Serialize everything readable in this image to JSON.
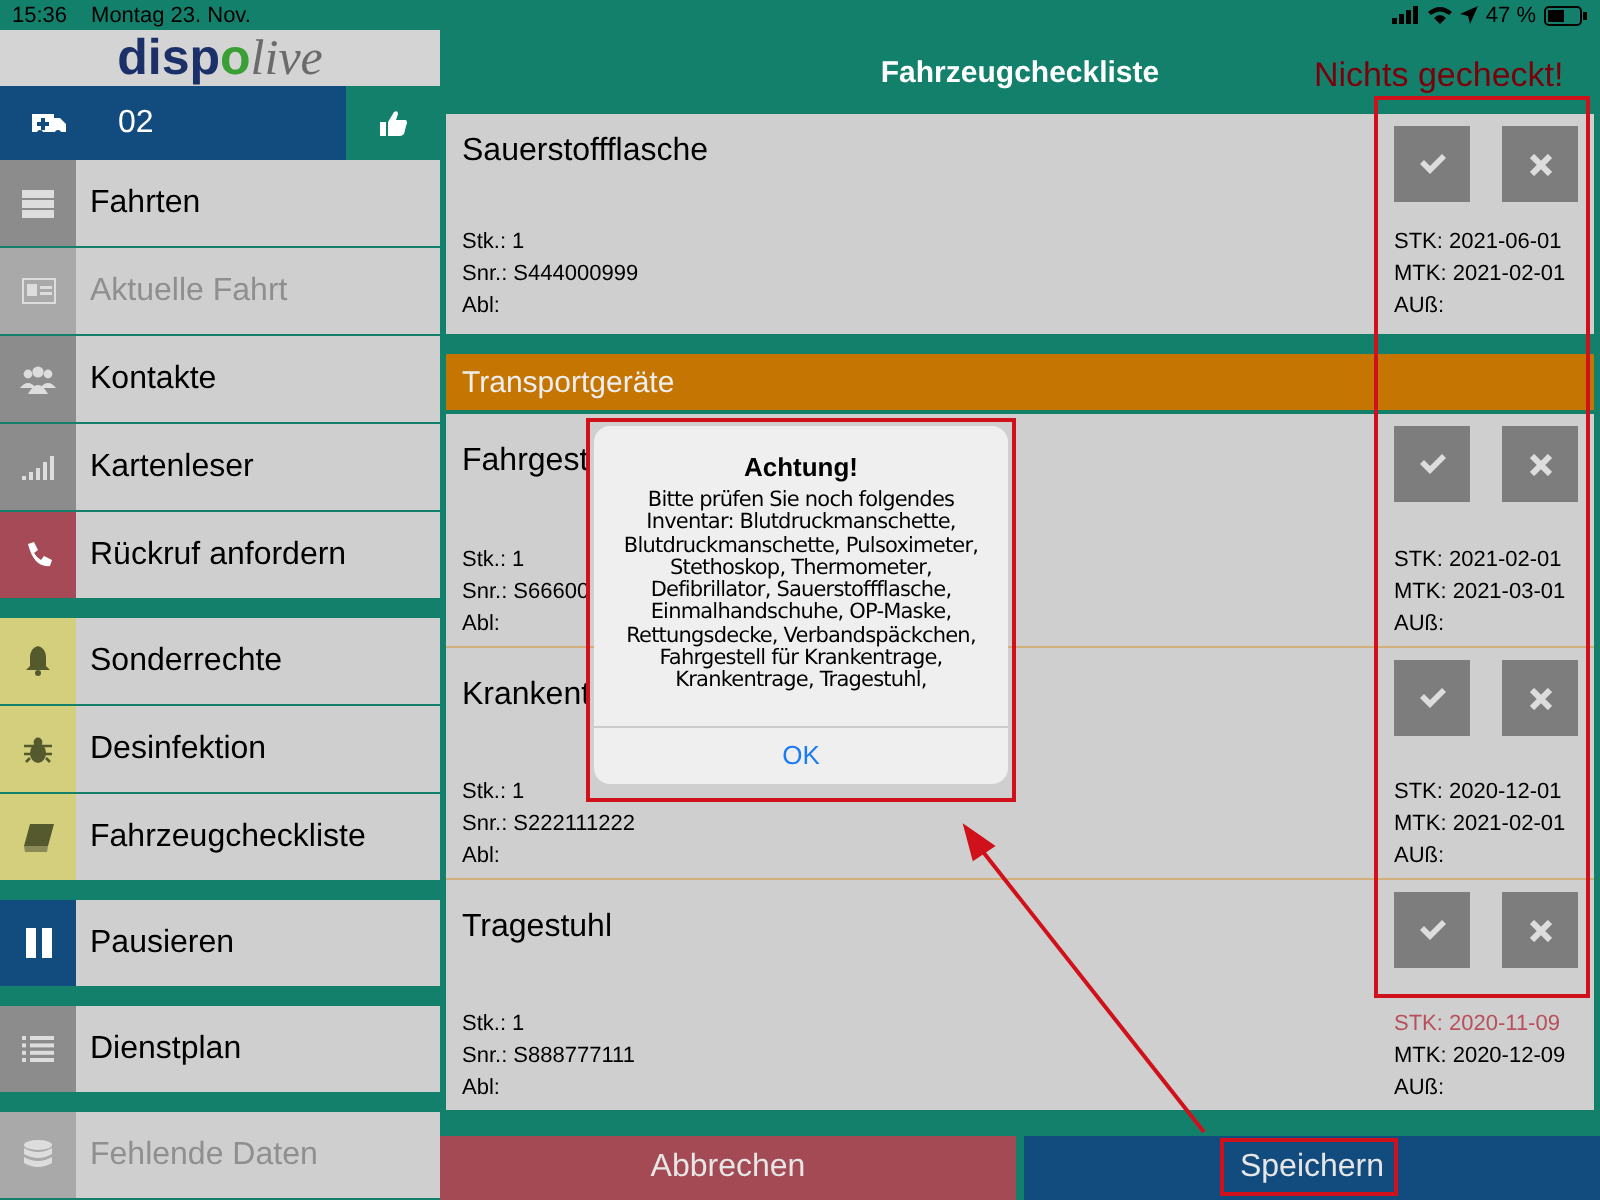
{
  "status_bar": {
    "time": "15:36",
    "date": "Montag 23. Nov.",
    "battery": "47 %"
  },
  "logo": {
    "primary": "disp",
    "accent": "o",
    "secondary": "live"
  },
  "vehicle": {
    "number": "02"
  },
  "sidebar": {
    "groups": [
      [
        {
          "label": "Fahrten",
          "kind": "list",
          "color": "#8c8c8c",
          "disabled": false
        },
        {
          "label": "Aktuelle Fahrt",
          "kind": "card",
          "color": "#a9a9a9",
          "disabled": true
        },
        {
          "label": "Kontakte",
          "kind": "people",
          "color": "#8c8c8c",
          "disabled": false
        },
        {
          "label": "Kartenleser",
          "kind": "signal",
          "color": "#8c8c8c",
          "disabled": false
        },
        {
          "label": "Rückruf anfordern",
          "kind": "phone",
          "color": "#a74a57",
          "disabled": false
        }
      ],
      [
        {
          "label": "Sonderrechte",
          "kind": "bell",
          "color": "#d3cf7d",
          "disabled": false
        },
        {
          "label": "Desinfektion",
          "kind": "bug",
          "color": "#d3cf7d",
          "disabled": false
        },
        {
          "label": "Fahrzeugcheckliste",
          "kind": "book",
          "color": "#d3cf7d",
          "disabled": false
        }
      ],
      [
        {
          "label": "Pausieren",
          "kind": "pause",
          "color": "#124c7e",
          "disabled": false
        }
      ],
      [
        {
          "label": "Dienstplan",
          "kind": "lines",
          "color": "#8c8c8c",
          "disabled": false
        }
      ],
      [
        {
          "label": "Fehlende Daten",
          "kind": "database",
          "color": "#a9a9a9",
          "disabled": true
        }
      ]
    ]
  },
  "header": {
    "title": "Fahrzeugcheckliste"
  },
  "checklist": [
    {
      "kind": "item",
      "title": "Sauerstoffflasche",
      "stk_count": "Stk.: 1",
      "serial": "Snr.: S444000999",
      "abl": "Abl:",
      "stk": "STK: 2021-06-01",
      "stk_overdue": false,
      "mtk": "MTK: 2021-02-01",
      "aus": "AUß:",
      "ok": false,
      "defect": false
    },
    {
      "kind": "category",
      "title": "Transportgeräte"
    },
    {
      "kind": "item",
      "title": "Fahrgest",
      "stk_count": "Stk.: 1",
      "serial": "Snr.: S66600",
      "abl": "Abl:",
      "stk": "STK: 2021-02-01",
      "stk_overdue": false,
      "mtk": "MTK: 2021-03-01",
      "aus": "AUß:",
      "ok": false,
      "defect": false
    },
    {
      "kind": "item",
      "title": "Krankent",
      "stk_count": "Stk.: 1",
      "serial": "Snr.: S222111222",
      "abl": "Abl:",
      "stk": "STK: 2020-12-01",
      "stk_overdue": false,
      "mtk": "MTK: 2021-02-01",
      "aus": "AUß:",
      "ok": false,
      "defect": false
    },
    {
      "kind": "item",
      "title": "Tragestuhl",
      "stk_count": "Stk.: 1",
      "serial": "Snr.: S888777111",
      "abl": "Abl:",
      "stk": "STK: 2020-11-09",
      "stk_overdue": true,
      "mtk": "MTK: 2020-12-09",
      "aus": "AUß:",
      "ok": false,
      "defect": false
    }
  ],
  "footer": {
    "cancel": "Abbrechen",
    "save": "Speichern"
  },
  "alert": {
    "title": "Achtung!",
    "message": "Bitte prüfen Sie noch folgendes Inventar: Blutdruckmanschette, Blutdruckmanschette, Pulsoximeter, Stethoskop, Thermometer, Defibrillator, Sauerstoffflasche, Einmalhandschuhe, OP-Maske, Rettungsdecke, Verbandspäckchen, Fahrgestell für Krankentrage, Krankentrage, Tragestuhl,",
    "button": "OK"
  },
  "annotation": {
    "label": "Nichts gecheckt!"
  }
}
